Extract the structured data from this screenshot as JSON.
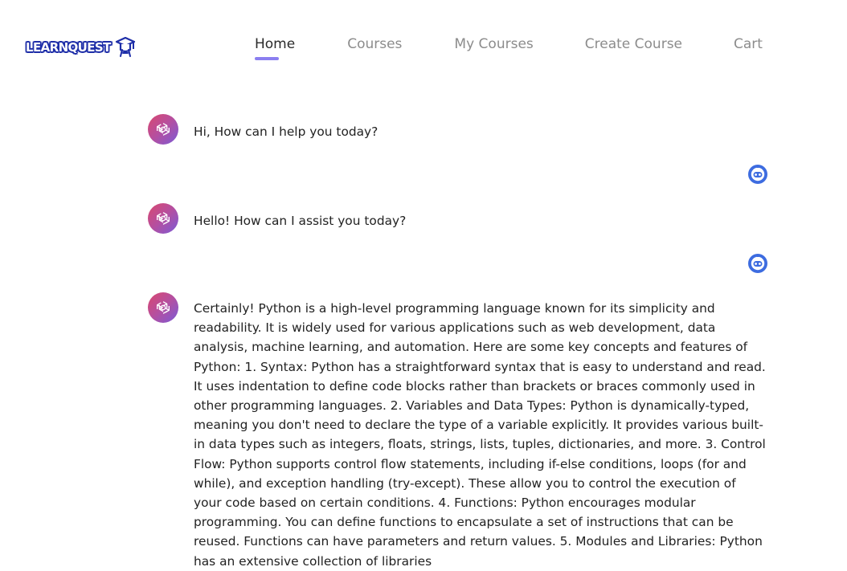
{
  "nav": {
    "logo_text": "LEARNQUEST",
    "links": [
      {
        "label": "Home",
        "active": true
      },
      {
        "label": "Courses",
        "active": false
      },
      {
        "label": "My Courses",
        "active": false
      },
      {
        "label": "Create Course",
        "active": false
      },
      {
        "label": "Cart",
        "active": false
      }
    ]
  },
  "chat": {
    "messages": [
      {
        "role": "bot",
        "text": "Hi, How can I help you today?"
      },
      {
        "role": "user",
        "text": ""
      },
      {
        "role": "bot",
        "text": "Hello! How can I assist you today?"
      },
      {
        "role": "user",
        "text": ""
      },
      {
        "role": "bot",
        "text": "Certainly! Python is a high-level programming language known for its simplicity and readability. It is widely used for various applications such as web development, data analysis, machine learning, and automation. Here are some key concepts and features of Python: 1. Syntax: Python has a straightforward syntax that is easy to understand and read. It uses indentation to define code blocks rather than brackets or braces commonly used in other programming languages. 2. Variables and Data Types: Python is dynamically-typed, meaning you don't need to declare the type of a variable explicitly. It provides various built-in data types such as integers, floats, strings, lists, tuples, dictionaries, and more. 3. Control Flow: Python supports control flow statements, including if-else conditions, loops (for and while), and exception handling (try-except). These allow you to control the execution of your code based on certain conditions. 4. Functions: Python encourages modular programming. You can define functions to encapsulate a set of instructions that can be reused. Functions can have parameters and return values. 5. Modules and Libraries: Python has an extensive collection of libraries"
      }
    ]
  },
  "colors": {
    "accent": "#8b7ff0",
    "logo_blue": "#1e2ea8",
    "user_icon_blue": "#3d6ce0",
    "nav_inactive": "#8c8c8c"
  },
  "icons": {
    "bot_avatar": "openai-logo-icon",
    "user_avatar": "bot-face-icon"
  }
}
